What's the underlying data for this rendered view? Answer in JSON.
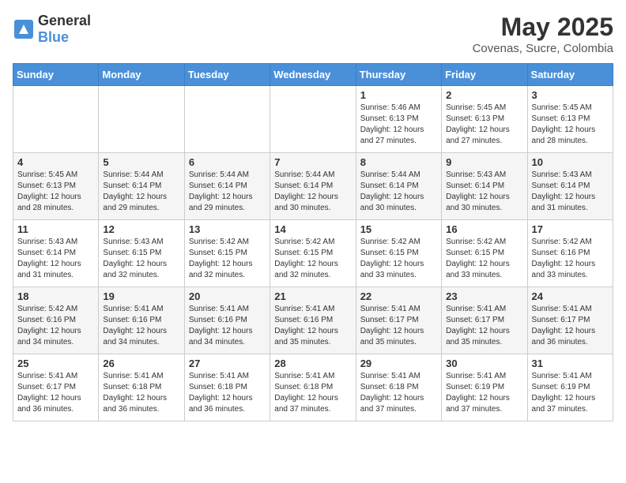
{
  "header": {
    "logo_general": "General",
    "logo_blue": "Blue",
    "month_year": "May 2025",
    "location": "Covenas, Sucre, Colombia"
  },
  "days_of_week": [
    "Sunday",
    "Monday",
    "Tuesday",
    "Wednesday",
    "Thursday",
    "Friday",
    "Saturday"
  ],
  "weeks": [
    [
      {
        "day": "",
        "detail": ""
      },
      {
        "day": "",
        "detail": ""
      },
      {
        "day": "",
        "detail": ""
      },
      {
        "day": "",
        "detail": ""
      },
      {
        "day": "1",
        "detail": "Sunrise: 5:46 AM\nSunset: 6:13 PM\nDaylight: 12 hours\nand 27 minutes."
      },
      {
        "day": "2",
        "detail": "Sunrise: 5:45 AM\nSunset: 6:13 PM\nDaylight: 12 hours\nand 27 minutes."
      },
      {
        "day": "3",
        "detail": "Sunrise: 5:45 AM\nSunset: 6:13 PM\nDaylight: 12 hours\nand 28 minutes."
      }
    ],
    [
      {
        "day": "4",
        "detail": "Sunrise: 5:45 AM\nSunset: 6:13 PM\nDaylight: 12 hours\nand 28 minutes."
      },
      {
        "day": "5",
        "detail": "Sunrise: 5:44 AM\nSunset: 6:14 PM\nDaylight: 12 hours\nand 29 minutes."
      },
      {
        "day": "6",
        "detail": "Sunrise: 5:44 AM\nSunset: 6:14 PM\nDaylight: 12 hours\nand 29 minutes."
      },
      {
        "day": "7",
        "detail": "Sunrise: 5:44 AM\nSunset: 6:14 PM\nDaylight: 12 hours\nand 30 minutes."
      },
      {
        "day": "8",
        "detail": "Sunrise: 5:44 AM\nSunset: 6:14 PM\nDaylight: 12 hours\nand 30 minutes."
      },
      {
        "day": "9",
        "detail": "Sunrise: 5:43 AM\nSunset: 6:14 PM\nDaylight: 12 hours\nand 30 minutes."
      },
      {
        "day": "10",
        "detail": "Sunrise: 5:43 AM\nSunset: 6:14 PM\nDaylight: 12 hours\nand 31 minutes."
      }
    ],
    [
      {
        "day": "11",
        "detail": "Sunrise: 5:43 AM\nSunset: 6:14 PM\nDaylight: 12 hours\nand 31 minutes."
      },
      {
        "day": "12",
        "detail": "Sunrise: 5:43 AM\nSunset: 6:15 PM\nDaylight: 12 hours\nand 32 minutes."
      },
      {
        "day": "13",
        "detail": "Sunrise: 5:42 AM\nSunset: 6:15 PM\nDaylight: 12 hours\nand 32 minutes."
      },
      {
        "day": "14",
        "detail": "Sunrise: 5:42 AM\nSunset: 6:15 PM\nDaylight: 12 hours\nand 32 minutes."
      },
      {
        "day": "15",
        "detail": "Sunrise: 5:42 AM\nSunset: 6:15 PM\nDaylight: 12 hours\nand 33 minutes."
      },
      {
        "day": "16",
        "detail": "Sunrise: 5:42 AM\nSunset: 6:15 PM\nDaylight: 12 hours\nand 33 minutes."
      },
      {
        "day": "17",
        "detail": "Sunrise: 5:42 AM\nSunset: 6:16 PM\nDaylight: 12 hours\nand 33 minutes."
      }
    ],
    [
      {
        "day": "18",
        "detail": "Sunrise: 5:42 AM\nSunset: 6:16 PM\nDaylight: 12 hours\nand 34 minutes."
      },
      {
        "day": "19",
        "detail": "Sunrise: 5:41 AM\nSunset: 6:16 PM\nDaylight: 12 hours\nand 34 minutes."
      },
      {
        "day": "20",
        "detail": "Sunrise: 5:41 AM\nSunset: 6:16 PM\nDaylight: 12 hours\nand 34 minutes."
      },
      {
        "day": "21",
        "detail": "Sunrise: 5:41 AM\nSunset: 6:16 PM\nDaylight: 12 hours\nand 35 minutes."
      },
      {
        "day": "22",
        "detail": "Sunrise: 5:41 AM\nSunset: 6:17 PM\nDaylight: 12 hours\nand 35 minutes."
      },
      {
        "day": "23",
        "detail": "Sunrise: 5:41 AM\nSunset: 6:17 PM\nDaylight: 12 hours\nand 35 minutes."
      },
      {
        "day": "24",
        "detail": "Sunrise: 5:41 AM\nSunset: 6:17 PM\nDaylight: 12 hours\nand 36 minutes."
      }
    ],
    [
      {
        "day": "25",
        "detail": "Sunrise: 5:41 AM\nSunset: 6:17 PM\nDaylight: 12 hours\nand 36 minutes."
      },
      {
        "day": "26",
        "detail": "Sunrise: 5:41 AM\nSunset: 6:18 PM\nDaylight: 12 hours\nand 36 minutes."
      },
      {
        "day": "27",
        "detail": "Sunrise: 5:41 AM\nSunset: 6:18 PM\nDaylight: 12 hours\nand 36 minutes."
      },
      {
        "day": "28",
        "detail": "Sunrise: 5:41 AM\nSunset: 6:18 PM\nDaylight: 12 hours\nand 37 minutes."
      },
      {
        "day": "29",
        "detail": "Sunrise: 5:41 AM\nSunset: 6:18 PM\nDaylight: 12 hours\nand 37 minutes."
      },
      {
        "day": "30",
        "detail": "Sunrise: 5:41 AM\nSunset: 6:19 PM\nDaylight: 12 hours\nand 37 minutes."
      },
      {
        "day": "31",
        "detail": "Sunrise: 5:41 AM\nSunset: 6:19 PM\nDaylight: 12 hours\nand 37 minutes."
      }
    ]
  ]
}
